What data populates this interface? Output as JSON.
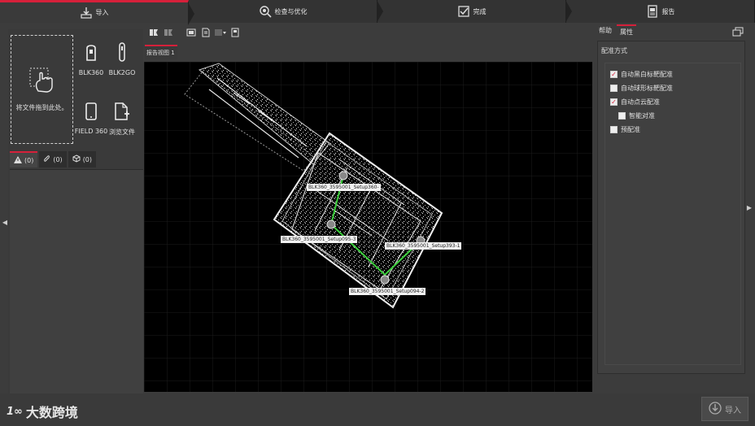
{
  "workflow": {
    "steps": [
      {
        "label": "导入",
        "icon": "import-icon"
      },
      {
        "label": "检查与优化",
        "icon": "inspect-icon"
      },
      {
        "label": "完成",
        "icon": "finish-icon"
      },
      {
        "label": "报告",
        "icon": "report-icon"
      }
    ]
  },
  "left": {
    "dropzone_label": "将文件拖到此处。",
    "devices": [
      {
        "label": "BLK360",
        "icon": "blk360-icon"
      },
      {
        "label": "BLK2GO",
        "icon": "blk2go-icon"
      },
      {
        "label": "FIELD 360",
        "icon": "tablet-icon"
      },
      {
        "label": "浏览文件",
        "icon": "add-file-icon"
      }
    ],
    "tabs": [
      {
        "label": "(0)",
        "icon": "warning-icon"
      },
      {
        "label": "(0)",
        "icon": "attachment-icon"
      },
      {
        "label": "(0)",
        "icon": "cube-icon"
      }
    ]
  },
  "viewer": {
    "tab_label": "报告视图 1",
    "scans": [
      {
        "label": "BLK360_3595001_Setup360-"
      },
      {
        "label": "BLK360_3595001_Setup095-3"
      },
      {
        "label": "BLK360_3595001_Setup393-1"
      },
      {
        "label": "BLK360_3595001_Setup094-2"
      }
    ]
  },
  "right": {
    "tabs": [
      "帮助",
      "属性"
    ],
    "section_title": "配准方式",
    "options": [
      {
        "label": "自动黑白标靶配准",
        "checked": true,
        "indent": false
      },
      {
        "label": "自动球形标靶配准",
        "checked": false,
        "indent": false
      },
      {
        "label": "自动点云配准",
        "checked": true,
        "indent": false
      },
      {
        "label": "智能对准",
        "checked": false,
        "indent": true
      },
      {
        "label": "预配准",
        "checked": false,
        "indent": false
      }
    ]
  },
  "watermark": {
    "logo": "1∞",
    "text": "大数跨境"
  },
  "import_button": {
    "label": "导入"
  },
  "colors": {
    "accent": "#d6203a",
    "link_line": "#3ccf3c"
  }
}
